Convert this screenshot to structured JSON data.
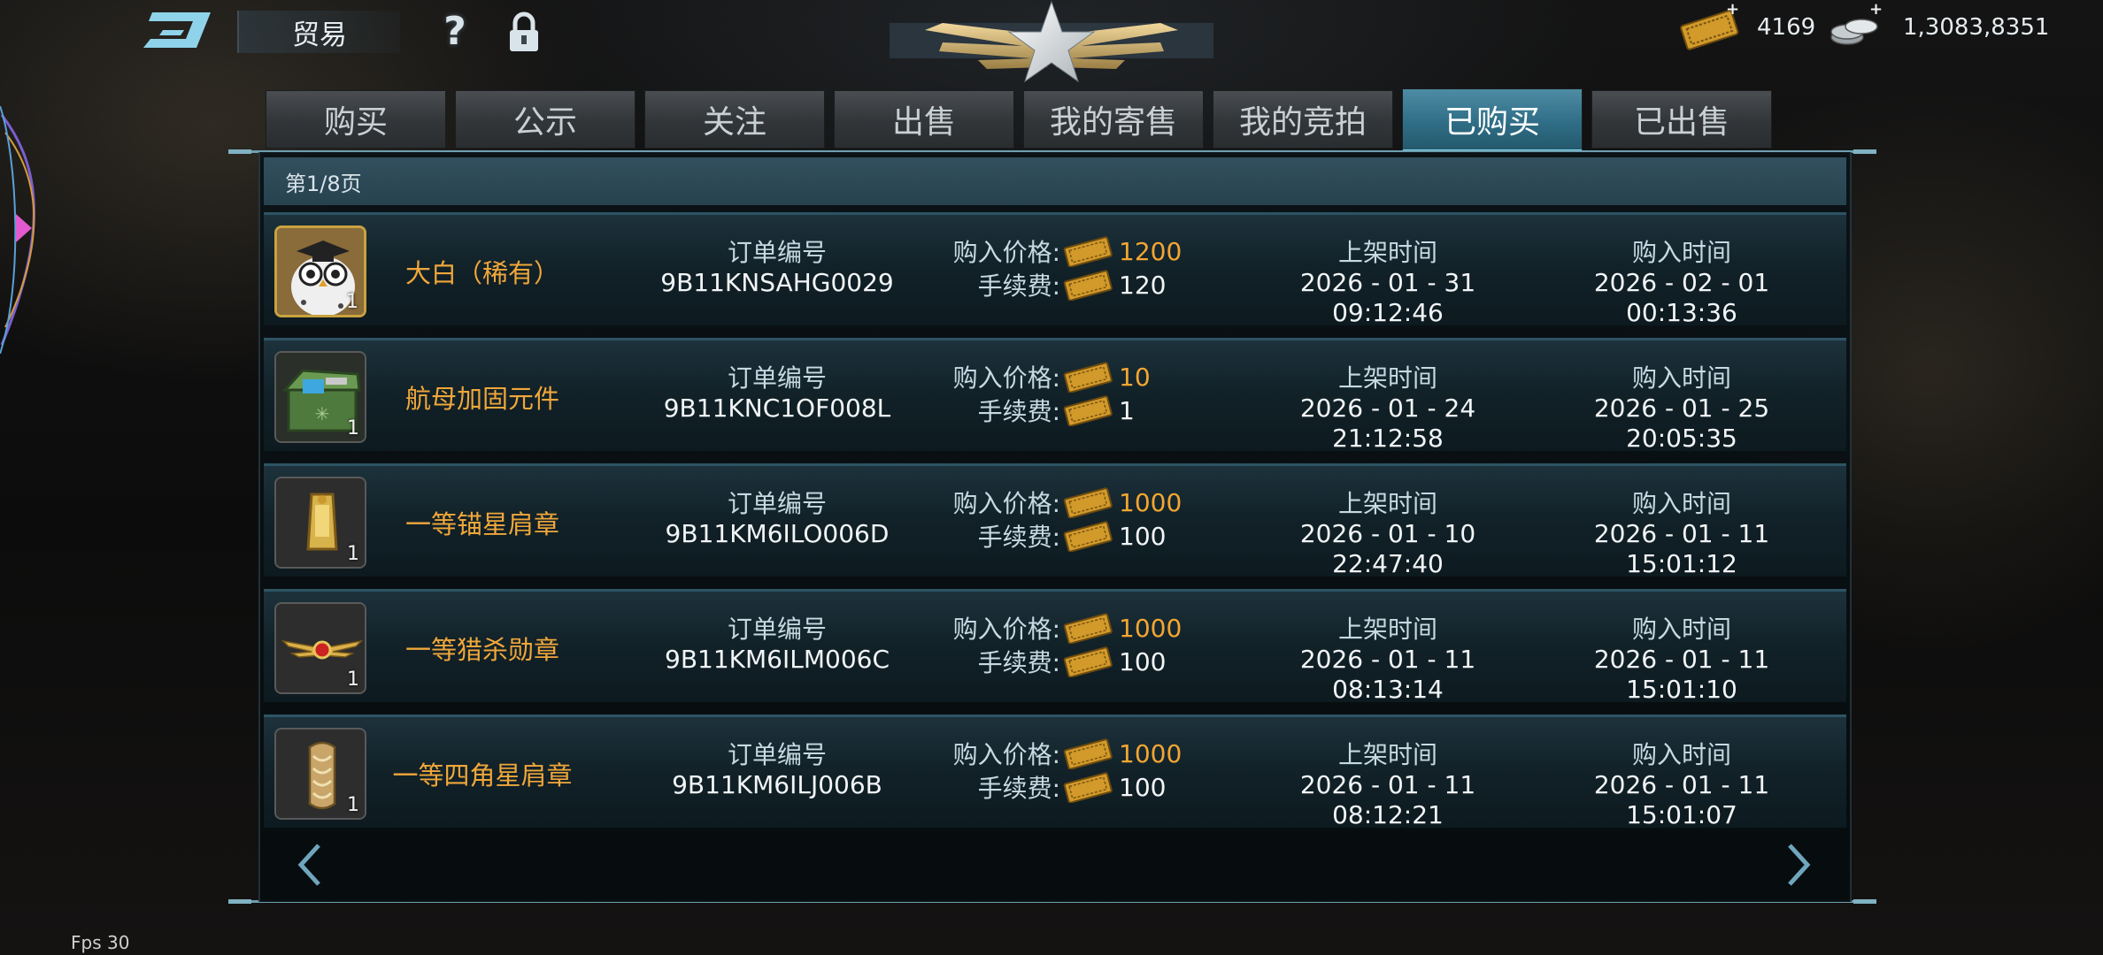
{
  "header": {
    "title": "贸易",
    "help_icon": "question-mark-icon",
    "lock_icon": "lock-icon",
    "emblem_icon": "star-wings-emblem",
    "ticket_balance": "4169",
    "coin_balance": "1,3083,8351",
    "plus_symbol": "+"
  },
  "tabs": [
    {
      "label": "购买",
      "active": false
    },
    {
      "label": "公示",
      "active": false
    },
    {
      "label": "关注",
      "active": false
    },
    {
      "label": "出售",
      "active": false
    },
    {
      "label": "我的寄售",
      "active": false
    },
    {
      "label": "我的竞拍",
      "active": false
    },
    {
      "label": "已购买",
      "active": true
    },
    {
      "label": "已出售",
      "active": false
    }
  ],
  "page_indicator": "第1/8页",
  "labels": {
    "order_no": "订单编号",
    "buy_price": "购入价格:",
    "fee": "手续费:",
    "listed_time": "上架时间",
    "bought_time": "购入时间"
  },
  "rows": [
    {
      "icon": "owl-pet-icon",
      "name": "大白（稀有）",
      "qty": "1",
      "order": "9B11KNSAHG0029",
      "price": "1200",
      "fee": "120",
      "listed": "2026 - 01 - 31 09:12:46",
      "bought": "2026 - 02 - 01 00:13:36"
    },
    {
      "icon": "supply-crate-icon",
      "name": "航母加固元件",
      "qty": "1",
      "order": "9B11KNC1OF008L",
      "price": "10",
      "fee": "1",
      "listed": "2026 - 01 - 24 21:12:58",
      "bought": "2026 - 01 - 25 20:05:35"
    },
    {
      "icon": "gold-epaulette-icon",
      "name": "一等锚星肩章",
      "qty": "1",
      "order": "9B11KM6ILO006D",
      "price": "1000",
      "fee": "100",
      "listed": "2026 - 01 - 10 22:47:40",
      "bought": "2026 - 01 - 11 15:01:12"
    },
    {
      "icon": "winged-medal-icon",
      "name": "一等猎杀勋章",
      "qty": "1",
      "order": "9B11KM6ILM006C",
      "price": "1000",
      "fee": "100",
      "listed": "2026 - 01 - 11 08:13:14",
      "bought": "2026 - 01 - 11 15:01:10"
    },
    {
      "icon": "braided-epaulette-icon",
      "name": "一等四角星肩章",
      "qty": "1",
      "order": "9B11KM6ILJ006B",
      "price": "1000",
      "fee": "100",
      "listed": "2026 - 01 - 11 08:12:21",
      "bought": "2026 - 01 - 11 15:01:07"
    }
  ],
  "fps_text": "Fps 30",
  "colors": {
    "accent_gold": "#f3a632",
    "active_tab": "#2f6e86",
    "row_border": "#2e5464"
  }
}
